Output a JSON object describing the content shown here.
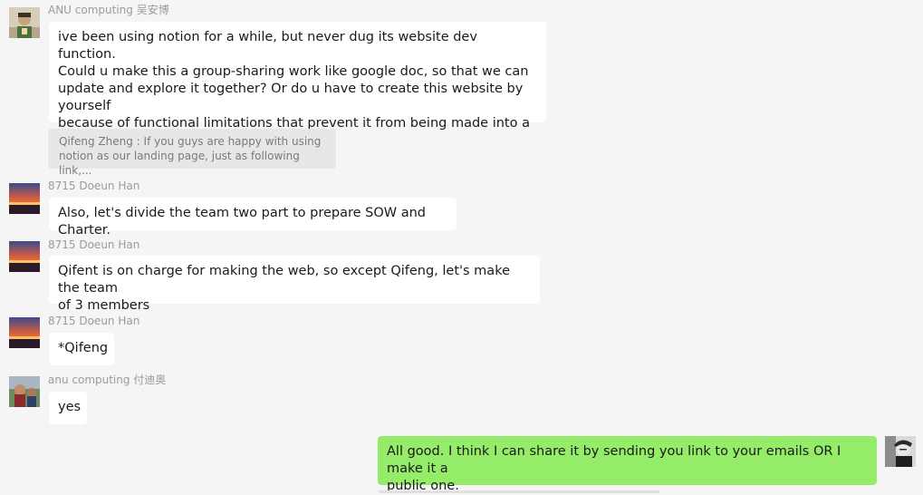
{
  "messages": [
    {
      "sender": "ANU computing 吴安博",
      "text": "ive been using notion for a while, but never dug its website dev function.\nCould u make this a group-sharing work like google doc, so that we can\nupdate and explore it together? Or do u have to create this website by yourself\nbecause of functional limitations that prevent it from being made into a shared\nproject?",
      "avatar": "avatar-person-icon"
    },
    {
      "quote": "Qifeng Zheng : If you guys are happy with using\nnotion as our landing page, just as following link,..."
    },
    {
      "sender": "8715 Doeun Han",
      "text": "Also, let's divide the team two part to prepare SOW and Charter.",
      "avatar": "avatar-sunset-icon"
    },
    {
      "sender": "8715 Doeun Han",
      "text": "Qifent is on charge for making the web, so except Qifeng, let's make the team\nof 3 members",
      "avatar": "avatar-sunset-icon"
    },
    {
      "sender": "8715 Doeun Han",
      "text": "*Qifeng",
      "avatar": "avatar-sunset-icon"
    },
    {
      "sender": "anu computing 付迪奥",
      "text": "yes",
      "avatar": "avatar-photo-icon"
    },
    {
      "self": true,
      "text": "All good. I think I can share it by sending you link to your emails OR I make it a\npublic one.",
      "avatar": "avatar-portrait-icon"
    }
  ],
  "colors": {
    "background": "#f5f5f5",
    "incoming_bubble": "#ffffff",
    "outgoing_bubble": "#95ec69",
    "quote_bg": "#e7e7e7",
    "sender_text": "#9b9b9b"
  }
}
